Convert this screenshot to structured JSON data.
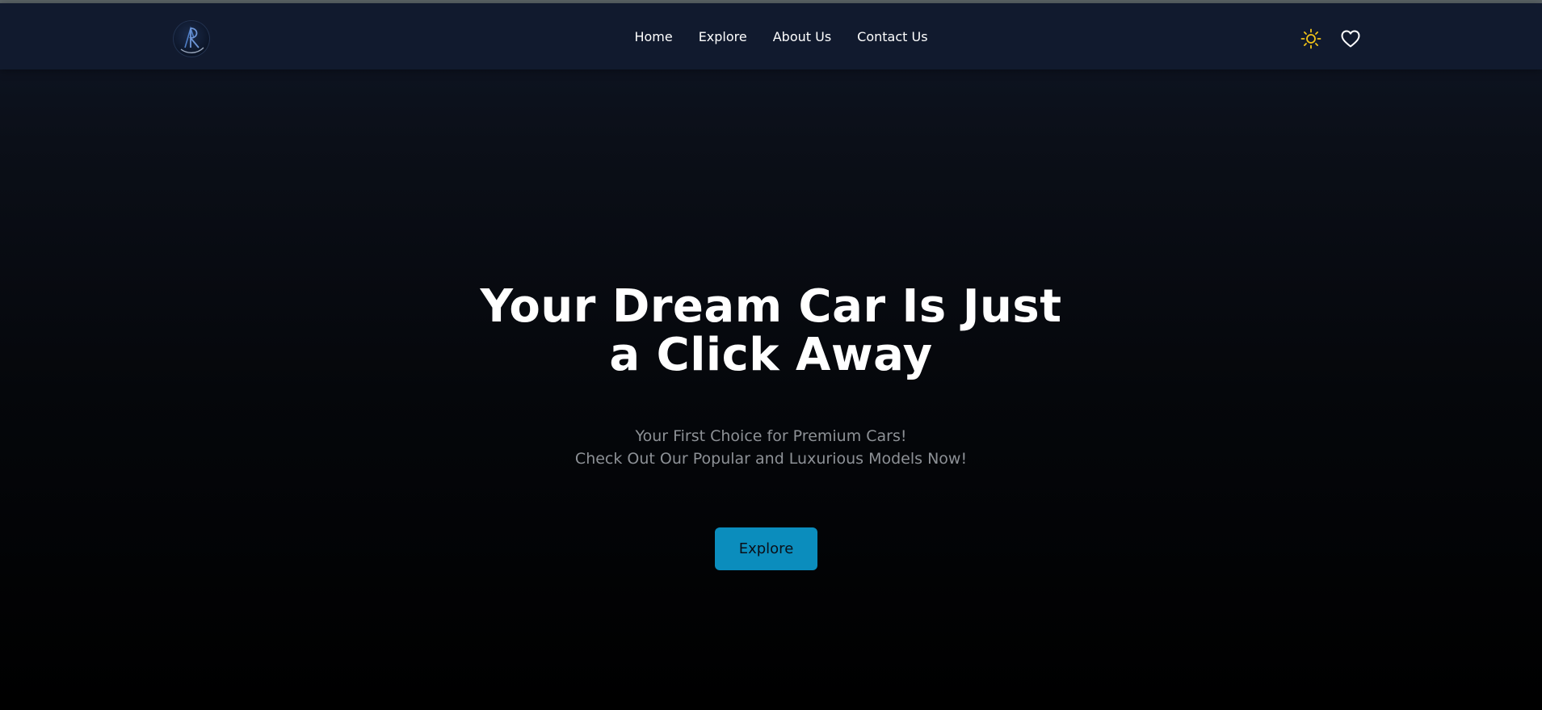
{
  "header": {
    "logo_icon": "ar-monogram-logo",
    "nav": [
      {
        "label": "Home"
      },
      {
        "label": "Explore"
      },
      {
        "label": "About Us"
      },
      {
        "label": "Contact Us"
      }
    ],
    "theme_toggle_icon": "sun-icon",
    "favorites_icon": "heart-icon"
  },
  "hero": {
    "title": "Your Dream Car Is Just a Click Away",
    "subtitle_line1": "Your First Choice for Premium Cars!",
    "subtitle_line2": "Check Out Our Popular and Luxurious Models Now!",
    "cta_label": "Explore"
  },
  "colors": {
    "accent": "#0b8dbd",
    "navbar_bg": "#111a2e",
    "sun": "#f2c318",
    "text": "#ffffff",
    "subtitle": "#8d9196"
  }
}
